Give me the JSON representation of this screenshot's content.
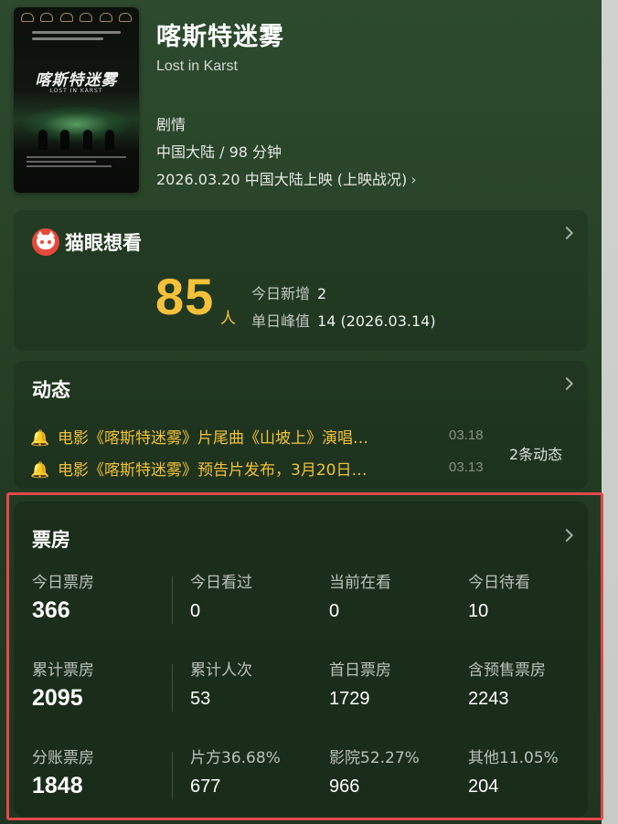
{
  "movie": {
    "title": "喀斯特迷雾",
    "subtitle": "Lost in Karst",
    "genre": "剧情",
    "region_duration": "中国大陆 / 98 分钟",
    "release": "2026.03.20 中国大陆上映 (上映战况)",
    "poster_title": "喀斯特迷雾",
    "poster_subtitle": "LOST IN KARST"
  },
  "want_to_see": {
    "title": "猫眼想看",
    "count": "85",
    "unit": "人",
    "today_new_label": "今日新增",
    "today_new_value": "2",
    "peak_label": "单日峰值",
    "peak_value": "14 (2026.03.14)"
  },
  "news": {
    "title": "动态",
    "items": [
      {
        "text": "电影《喀斯特迷雾》片尾曲《山坡上》演唱…",
        "date": "03.18"
      },
      {
        "text": "电影《喀斯特迷雾》预告片发布，3月20日…",
        "date": "03.13"
      }
    ],
    "count_label": "2条动态"
  },
  "box_office": {
    "title": "票房",
    "rows": [
      [
        {
          "label": "今日票房",
          "value": "366"
        },
        {
          "label": "今日看过",
          "value": "0"
        },
        {
          "label": "当前在看",
          "value": "0"
        },
        {
          "label": "今日待看",
          "value": "10"
        }
      ],
      [
        {
          "label": "累计票房",
          "value": "2095"
        },
        {
          "label": "累计人次",
          "value": "53"
        },
        {
          "label": "首日票房",
          "value": "1729"
        },
        {
          "label": "含预售票房",
          "value": "2243"
        }
      ],
      [
        {
          "label": "分账票房",
          "value": "1848"
        },
        {
          "label": "片方36.68%",
          "value": "677"
        },
        {
          "label": "影院52.27%",
          "value": "966"
        },
        {
          "label": "其他11.05%",
          "value": "204"
        }
      ]
    ]
  },
  "colors": {
    "accent_yellow": "#f5c13a",
    "maoyan_red": "#e64a3b",
    "highlight_red": "#e5484d"
  }
}
